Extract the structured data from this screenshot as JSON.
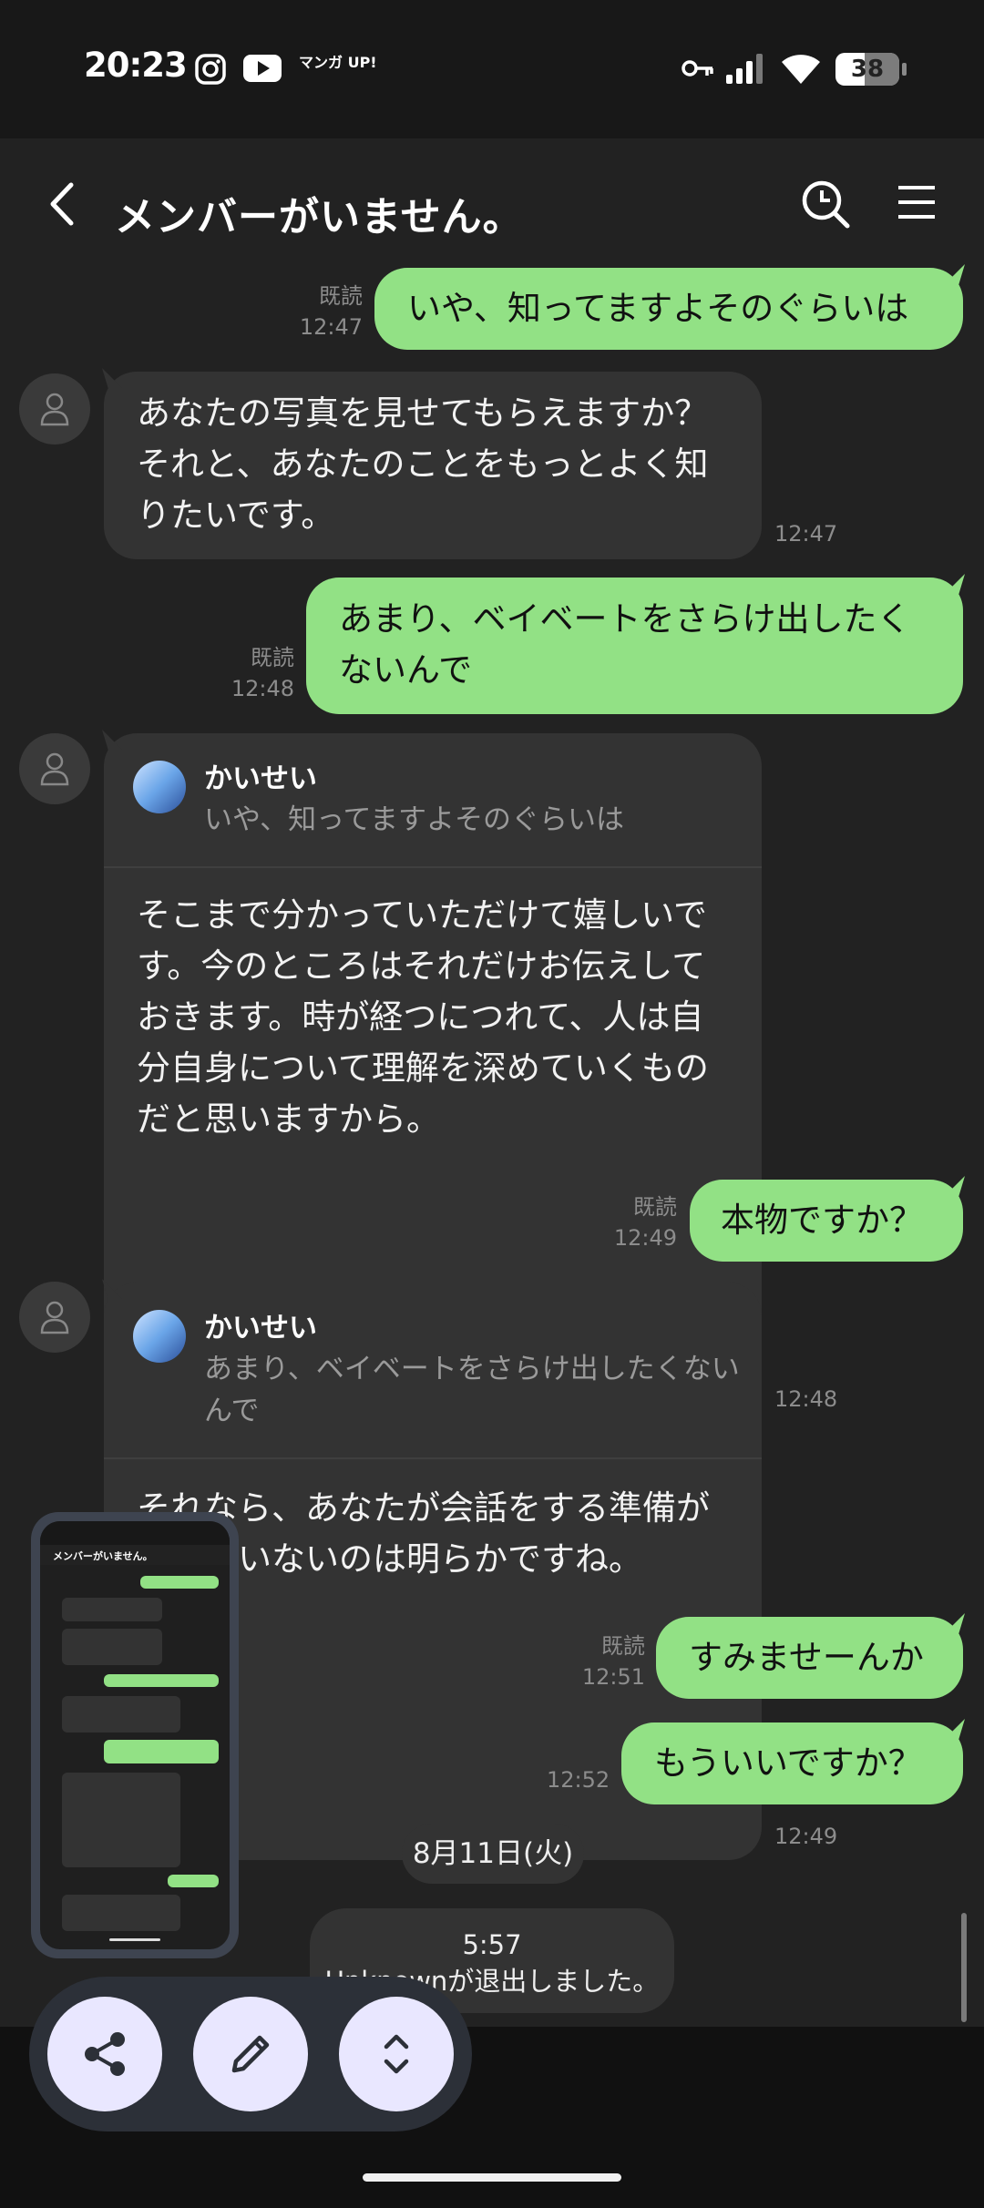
{
  "status_bar": {
    "time": "20:23",
    "manga_app_label": "マンガ UP!",
    "battery_level": "38"
  },
  "header": {
    "title": "メンバーがいません。"
  },
  "messages": [
    {
      "dir": "out",
      "text": "いや、知ってますよそのぐらいは",
      "read": "既読",
      "time": "12:47"
    },
    {
      "dir": "in",
      "text": "あなたの写真を見せてもらえますか？それと、あなたのことをもっとよく知りたいです。",
      "time": "12:47"
    },
    {
      "dir": "out",
      "text": "あまり、ベイベートをさらけ出したくないんで",
      "read": "既読",
      "time": "12:48"
    },
    {
      "dir": "in",
      "reply_name": "かいせい",
      "reply_quote": "いや、知ってますよそのぐらいは",
      "text": "そこまで分かっていただけて嬉しいです。今のところはそれだけお伝えしておきます。時が経つにつれて、人は自分自身について理解を深めていくものだと思いますから。",
      "time": "12:48"
    },
    {
      "dir": "out",
      "text": "本物ですか？",
      "read": "既読",
      "time": "12:49"
    },
    {
      "dir": "in",
      "reply_name": "かいせい",
      "reply_quote": "あまり、ベイベートをさらけ出したくないんで",
      "text": "それなら、あなたが会話をする準備ができていないのは明らかですね。",
      "time": "12:49"
    },
    {
      "dir": "out",
      "text": "すみませーんか",
      "read": "既読",
      "time": "12:51"
    },
    {
      "dir": "out",
      "text": "もういいですか？",
      "time": "12:52"
    }
  ],
  "date_divider": "8月11日(火)",
  "system_notice": {
    "time": "5:57",
    "text": "Unknownが退出しました。"
  },
  "thumbnail": {
    "title": "メンバーがいません。"
  },
  "toolbar": {
    "icons": [
      "share-icon",
      "edit-icon",
      "expand-icon"
    ]
  },
  "colors": {
    "outgoing_bubble": "#92e185",
    "incoming_bubble": "#333333",
    "background": "#222222"
  }
}
